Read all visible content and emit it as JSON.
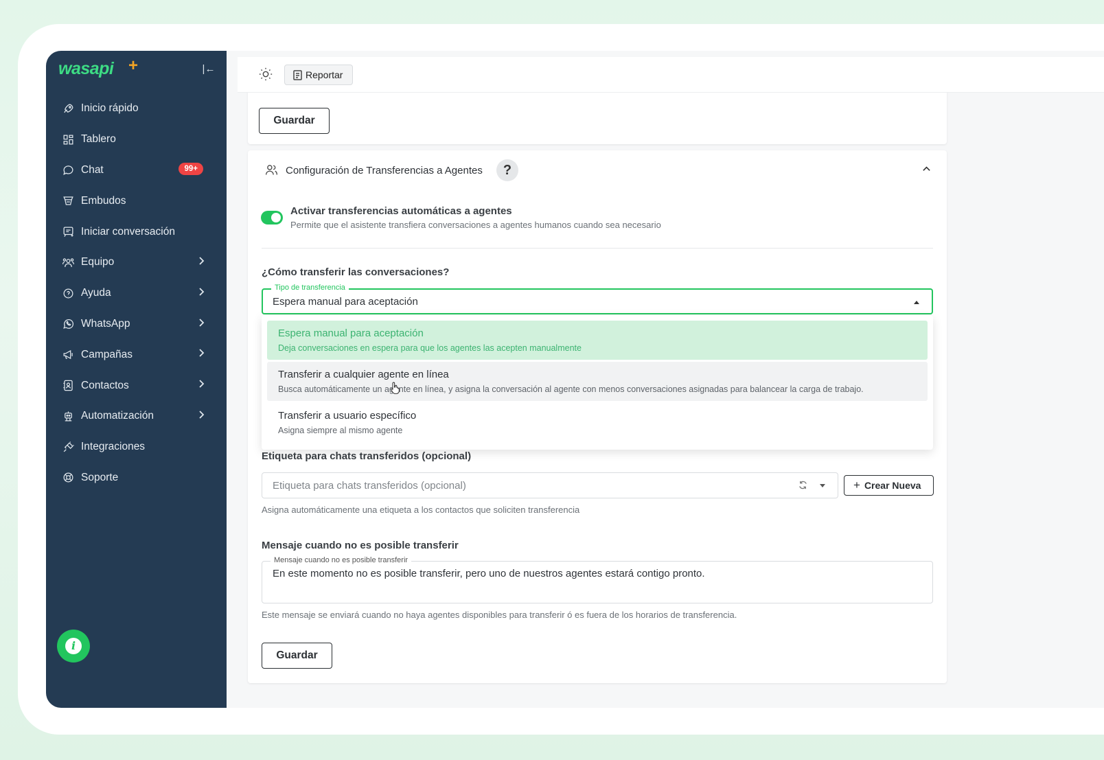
{
  "sidebar": {
    "logo": "wasapi",
    "logo_plus": "+",
    "collapse_icon": "collapse-left-icon",
    "items": [
      {
        "label": "Inicio rápido",
        "icon": "rocket-icon"
      },
      {
        "label": "Tablero",
        "icon": "dashboard-icon"
      },
      {
        "label": "Chat",
        "icon": "chat-bubble-icon",
        "badge": "99+"
      },
      {
        "label": "Embudos",
        "icon": "funnel-icon"
      },
      {
        "label": "Iniciar conversación",
        "icon": "new-message-icon"
      },
      {
        "label": "Equipo",
        "icon": "team-icon",
        "chevron": true
      },
      {
        "label": "Ayuda",
        "icon": "help-icon",
        "chevron": true
      },
      {
        "label": "WhatsApp",
        "icon": "whatsapp-icon",
        "chevron": true
      },
      {
        "label": "Campañas",
        "icon": "megaphone-icon",
        "chevron": true
      },
      {
        "label": "Contactos",
        "icon": "contacts-icon",
        "chevron": true
      },
      {
        "label": "Automatización",
        "icon": "robot-icon",
        "chevron": true
      },
      {
        "label": "Integraciones",
        "icon": "plug-icon"
      },
      {
        "label": "Soporte",
        "icon": "lifebuoy-icon"
      }
    ],
    "info_icon": "info-icon"
  },
  "topbar": {
    "theme_icon": "sun-icon",
    "report_label": "Reportar"
  },
  "top_card": {
    "save_label": "Guardar"
  },
  "transfer_card": {
    "title": "Configuración de Transferencias a Agentes",
    "help_label": "?",
    "toggle_label": "Activar transferencias automáticas a agentes",
    "toggle_desc": "Permite que el asistente transfiera conversaciones a agentes humanos cuando sea necesario",
    "toggle_on": true,
    "how_label": "¿Cómo transferir las conversaciones?",
    "select_legend": "Tipo de transferencia",
    "select_value": "Espera manual para aceptación",
    "options": [
      {
        "title": "Espera manual para aceptación",
        "desc": "Deja conversaciones en espera para que los agentes las acepten manualmente"
      },
      {
        "title": "Transferir a cualquier agente en línea",
        "desc": "Busca automáticamente un agente en línea, y asigna la conversación al agente con menos conversaciones asignadas para balancear la carga de trabajo."
      },
      {
        "title": "Transferir a usuario específico",
        "desc": "Asigna siempre al mismo agente"
      }
    ],
    "tag_label": "Etiqueta para chats transferidos (opcional)",
    "tag_placeholder": "Etiqueta para chats transferidos (opcional)",
    "tag_helper": "Asigna automáticamente una etiqueta a los contactos que soliciten transferencia",
    "create_new_label": "Crear Nueva",
    "msg_label": "Mensaje cuando no es posible transferir",
    "msg_legend": "Mensaje cuando no es posible transferir",
    "msg_value": "En este momento no es posible transferir, pero uno de nuestros agentes estará contigo pronto.",
    "msg_helper": "Este mensaje se enviará cuando no haya agentes disponibles para transferir ó es fuera de los horarios de transferencia.",
    "save_label": "Guardar"
  },
  "colors": {
    "sidebar_bg": "#243b53",
    "accent": "#22c55e",
    "badge": "#ef4444"
  }
}
